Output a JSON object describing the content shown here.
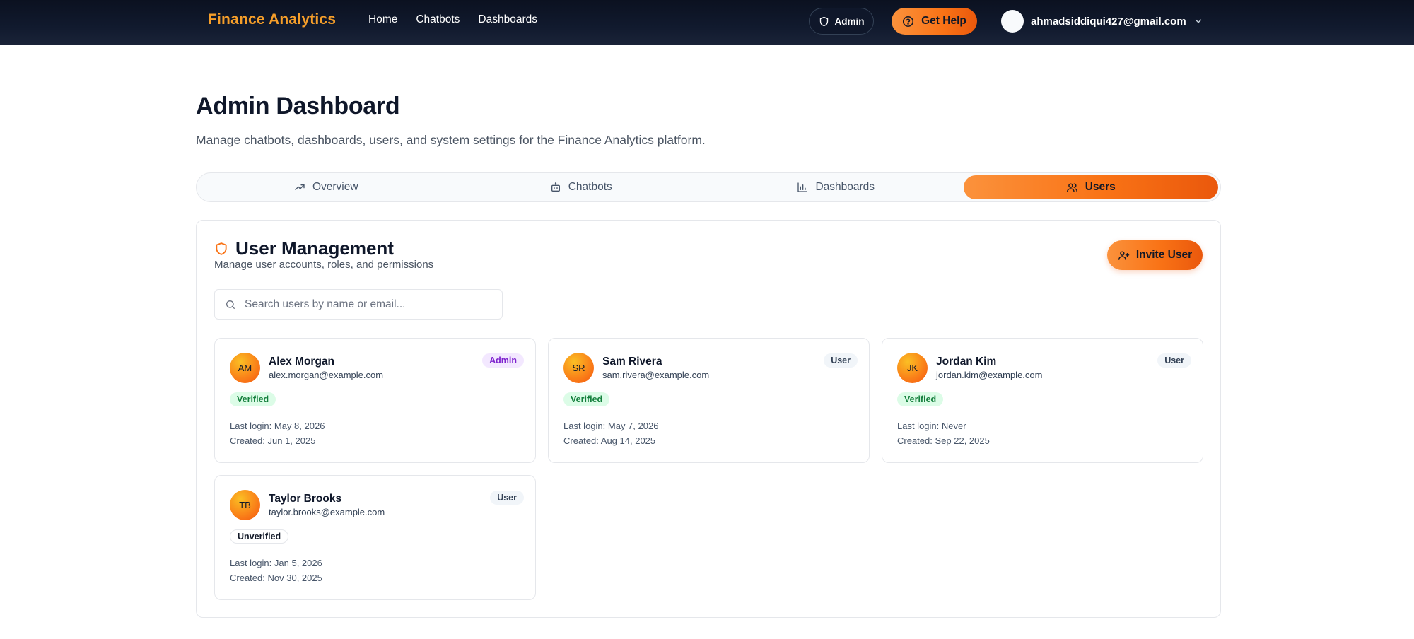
{
  "navbar": {
    "brand": "Finance Analytics",
    "links": [
      "Home",
      "Chatbots",
      "Dashboards"
    ],
    "admin_label": "Admin",
    "help_label": "Get Help",
    "user_email": "ahmadsiddiqui427@gmail.com"
  },
  "header": {
    "title": "Admin Dashboard",
    "subtitle": "Manage chatbots, dashboards, users, and system settings for the Finance Analytics platform."
  },
  "tabs": [
    {
      "label": "Overview",
      "icon": "trending-up-icon",
      "active": false
    },
    {
      "label": "Chatbots",
      "icon": "bot-icon",
      "active": false
    },
    {
      "label": "Dashboards",
      "icon": "bar-chart-icon",
      "active": false
    },
    {
      "label": "Users",
      "icon": "users-icon",
      "active": true
    }
  ],
  "panel": {
    "title": "User Management",
    "description": "Manage user accounts, roles, and permissions",
    "invite_label": "Invite User",
    "search_placeholder": "Search users by name or email..."
  },
  "users": [
    {
      "initials": "AM",
      "name": "Alex Morgan",
      "email": "alex.morgan@example.com",
      "role": "Admin",
      "status": "Verified",
      "last_login_label": "Last login:",
      "last_login": "May 8, 2026",
      "created_label": "Created:",
      "created": "Jun 1, 2025"
    },
    {
      "initials": "SR",
      "name": "Sam Rivera",
      "email": "sam.rivera@example.com",
      "role": "User",
      "status": "Verified",
      "last_login_label": "Last login:",
      "last_login": "May 7, 2026",
      "created_label": "Created:",
      "created": "Aug 14, 2025"
    },
    {
      "initials": "JK",
      "name": "Jordan Kim",
      "email": "jordan.kim@example.com",
      "role": "User",
      "status": "Verified",
      "last_login_label": "Last login:",
      "last_login": "Never",
      "created_label": "Created:",
      "created": "Sep 22, 2025"
    },
    {
      "initials": "TB",
      "name": "Taylor Brooks",
      "email": "taylor.brooks@example.com",
      "role": "User",
      "status": "Unverified",
      "last_login_label": "Last login:",
      "last_login": "Jan 5, 2026",
      "created_label": "Created:",
      "created": "Nov 30, 2025"
    }
  ],
  "colors": {
    "accent": "#f97316",
    "brand": "#f59e2a",
    "navbar_bg": "#0b1120",
    "admin_badge": "#7e22ce",
    "verified_badge": "#15803d"
  }
}
